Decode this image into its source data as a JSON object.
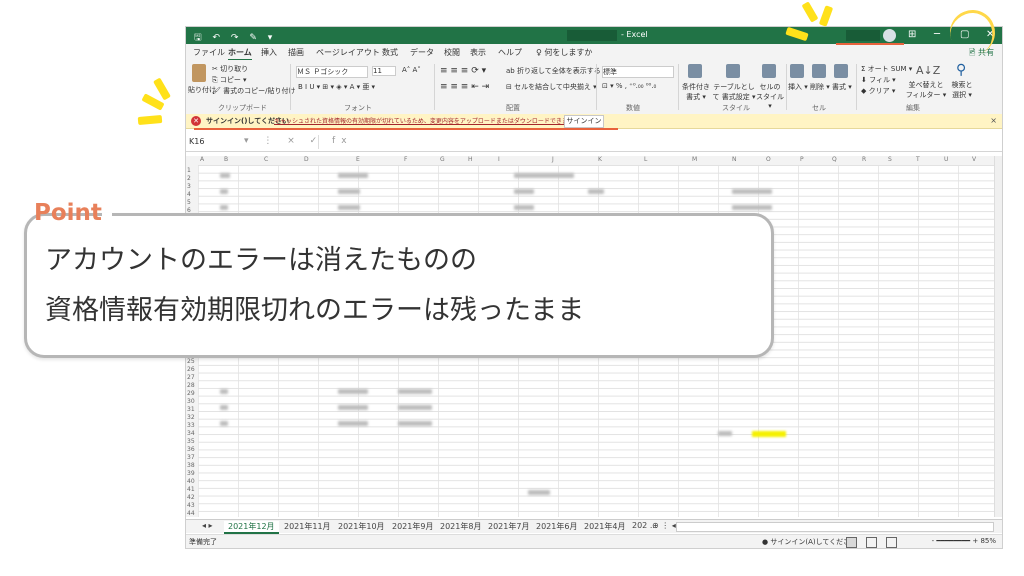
{
  "titlebar": {
    "quick_access": "🖫 ↶ ↷ ✎ ▾",
    "app_name": "- Excel",
    "window_controls": [
      "⊞",
      "─",
      "▢",
      "✕"
    ]
  },
  "tabs": [
    "ファイル",
    "ホーム",
    "挿入",
    "描画",
    "ページレイアウト",
    "数式",
    "データ",
    "校閲",
    "表示",
    "ヘルプ",
    "♀ 何をしますか"
  ],
  "share_label": "🖻 共有",
  "ribbon": {
    "clipboard": {
      "paste": "貼り付け",
      "cut": "✂ 切り取り",
      "copy": "⎘ コピー ▾",
      "format_painter": "🖌 書式のコピー/貼り付け",
      "label": "クリップボード"
    },
    "font": {
      "name": "ＭＳ Ｐゴシック",
      "size": "11",
      "grow": "A˄ A˅",
      "styles": "B  I  U ▾ ⊞ ▾ ◈ ▾ A ▾ 亜 ▾",
      "label": "フォント"
    },
    "alignment": {
      "wrap": "ab 折り返して全体を表示する",
      "merge": "⊟ セルを結合して中央揃え ▾",
      "label": "配置"
    },
    "number": {
      "format": "標準",
      "buttons": "⊡ ▾ %  ,  ⁺⁰.₀₀ ⁰⁰.₀",
      "label": "数値"
    },
    "styles": {
      "conditional": "条件付き 書式 ▾",
      "table": "テーブルとして 書式設定 ▾",
      "cell": "セルの スタイル ▾",
      "label": "スタイル"
    },
    "cells": {
      "insert": "挿入 ▾",
      "delete": "削除 ▾",
      "format": "書式 ▾",
      "label": "セル"
    },
    "editing": {
      "autosum": "Σ オート SUM ▾",
      "fill": "⬇ フィル ▾",
      "clear": "◆ クリア ▾",
      "sort": "並べ替えと フィルター ▾",
      "find": "検索と 選択 ▾",
      "label": "編集"
    }
  },
  "warning": {
    "icon": "✕",
    "title": "サインイン()してください",
    "message": "キャッシュされた資格情報の有効期限が切れているため、変更内容をアップロードまたはダウンロードできません。",
    "button": "サインイン",
    "close": "×"
  },
  "formula_bar": {
    "name_box": "K16",
    "controls": "▾ ⋮ × ✓ fx"
  },
  "columns": [
    "A",
    "B",
    "C",
    "D",
    "E",
    "F",
    "G",
    "H",
    "I",
    "J",
    "K",
    "L",
    "M",
    "N",
    "O",
    "P",
    "Q",
    "R",
    "S",
    "T",
    "U",
    "V"
  ],
  "rows": [
    "1",
    "2",
    "3",
    "4",
    "5",
    "6",
    "25",
    "26",
    "27",
    "28",
    "29",
    "30",
    "31",
    "32",
    "33",
    "34",
    "35",
    "36",
    "37",
    "38",
    "39",
    "40",
    "41",
    "42",
    "43",
    "44",
    "45"
  ],
  "sheet_tabs": {
    "nav": "◂ ▸",
    "tabs": [
      "2021年12月",
      "2021年11月",
      "2021年10月",
      "2021年9月",
      "2021年8月",
      "2021年7月",
      "2021年6月",
      "2021年4月",
      "202 ..."
    ],
    "add": "⊕ ⋮ ◂"
  },
  "status": {
    "ready": "準備完了",
    "signin": "● サインイン(A)してください",
    "zoom_text": "- ━━━━━━━━ + 85%"
  },
  "callout": {
    "label": "Point",
    "line1": "アカウントのエラーは消えたものの",
    "line2": "資格情報有効期限切れのエラーは残ったまま"
  },
  "colors": {
    "excel_green": "#217346",
    "warning_bg": "#fff4c4",
    "highlight_red": "#e8623c",
    "point_orange": "#e8805a",
    "spark_yellow": "#ffe11a"
  }
}
